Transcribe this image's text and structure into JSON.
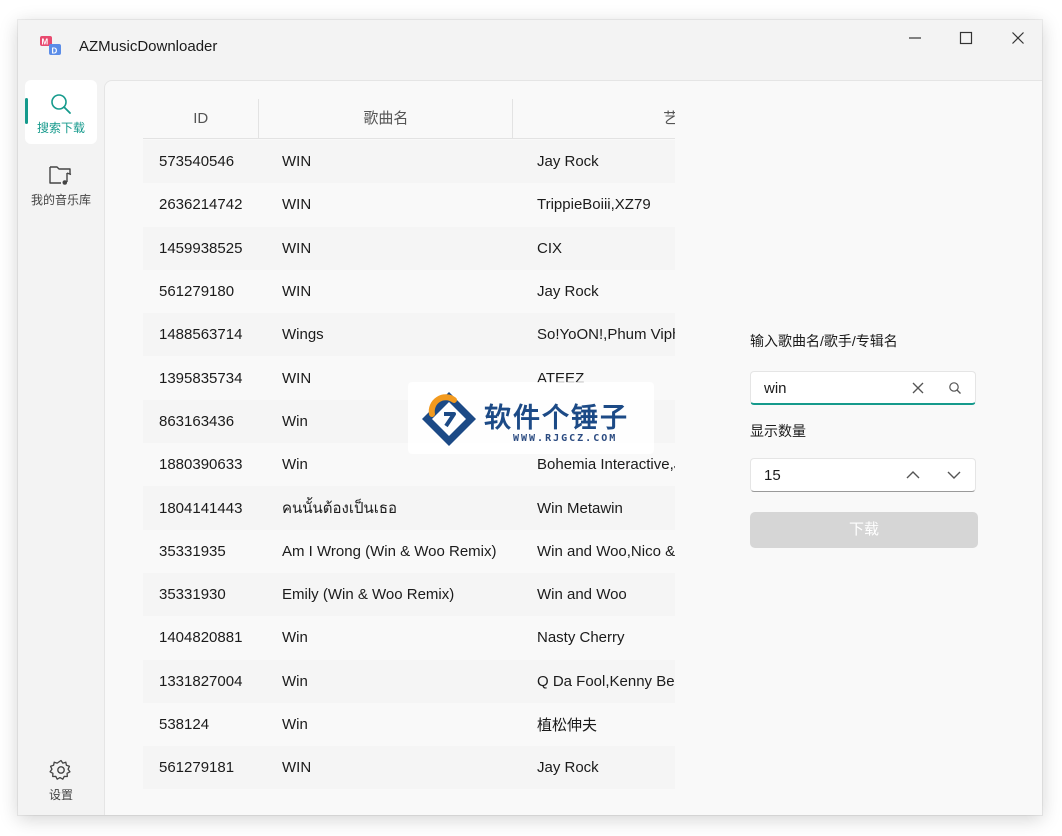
{
  "app": {
    "title": "AZMusicDownloader",
    "logo_text": "MD"
  },
  "sidebar": {
    "items": [
      {
        "label": "搜索下载",
        "icon": "search-icon",
        "active": true
      },
      {
        "label": "我的音乐库",
        "icon": "music-folder-icon",
        "active": false
      }
    ],
    "settings": {
      "label": "设置",
      "icon": "gear-icon"
    }
  },
  "table": {
    "columns": [
      "ID",
      "歌曲名",
      "艺"
    ],
    "rows": [
      {
        "id": "573540546",
        "name": "WIN",
        "artist": "Jay Rock"
      },
      {
        "id": "2636214742",
        "name": "WIN",
        "artist": "TrippieBoiii,XZ79"
      },
      {
        "id": "1459938525",
        "name": "WIN",
        "artist": "CIX"
      },
      {
        "id": "561279180",
        "name": "WIN",
        "artist": "Jay Rock"
      },
      {
        "id": "1488563714",
        "name": "Wings",
        "artist": "So!YoON!,Phum Viph"
      },
      {
        "id": "1395835734",
        "name": "WIN",
        "artist": "ATEEZ"
      },
      {
        "id": "863163436",
        "name": "Win",
        "artist": ""
      },
      {
        "id": "1880390633",
        "name": "Win",
        "artist": "Bohemia Interactive,J"
      },
      {
        "id": "1804141443",
        "name": "คนนั้นต้องเป็นเธอ",
        "artist": "Win Metawin"
      },
      {
        "id": "35331935",
        "name": "Am I Wrong (Win & Woo Remix)",
        "artist": "Win and Woo,Nico &"
      },
      {
        "id": "35331930",
        "name": "Emily (Win & Woo Remix)",
        "artist": "Win and Woo"
      },
      {
        "id": "1404820881",
        "name": "Win",
        "artist": "Nasty Cherry"
      },
      {
        "id": "1331827004",
        "name": "Win",
        "artist": "Q Da Fool,Kenny Bea"
      },
      {
        "id": "538124",
        "name": "Win",
        "artist": "植松伸夫"
      },
      {
        "id": "561279181",
        "name": "WIN",
        "artist": "Jay Rock"
      }
    ]
  },
  "search": {
    "label": "输入歌曲名/歌手/专辑名",
    "value": "win",
    "count_label": "显示数量",
    "count_value": "15",
    "download_label": "下载"
  },
  "watermark": {
    "name": "软件个锤子",
    "url": "WWW.RJGCZ.COM"
  },
  "colors": {
    "accent": "#159a8c",
    "window_bg": "#f3f3f3",
    "disabled_button": "#d6d6d6"
  }
}
